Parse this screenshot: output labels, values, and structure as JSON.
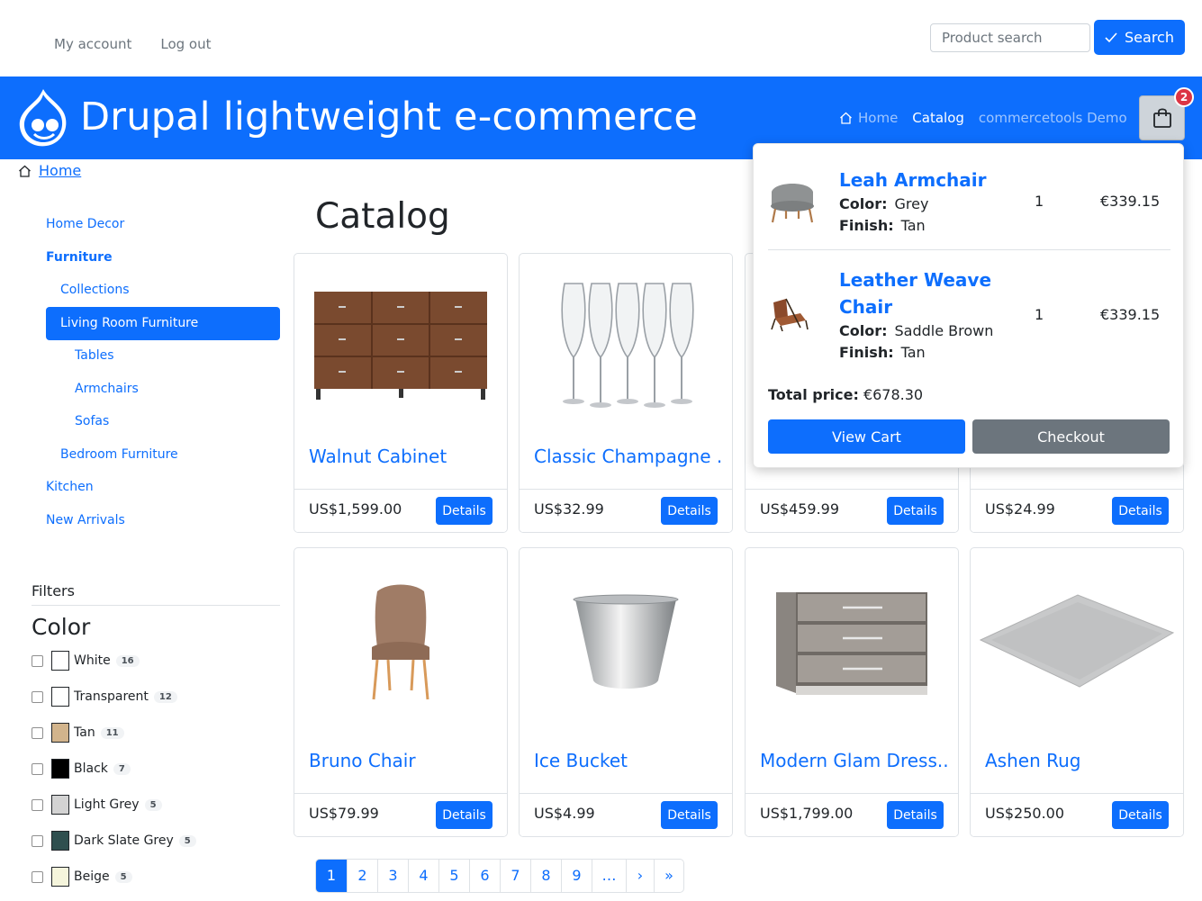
{
  "topnav": {
    "my_account": "My account",
    "logout": "Log out"
  },
  "search": {
    "placeholder": "Product search",
    "button": "Search"
  },
  "header": {
    "site_title": "Drupal lightweight e-commerce",
    "nav": {
      "home": "Home",
      "catalog": "Catalog",
      "demo": "commercetools Demo"
    },
    "cart_count": "2",
    "brand_color": "#0d6efd"
  },
  "breadcrumb": {
    "home": "Home"
  },
  "sidebar": {
    "categories": [
      {
        "label": "Home Decor"
      },
      {
        "label": "Furniture"
      },
      {
        "label": "Collections"
      },
      {
        "label": "Living Room Furniture"
      },
      {
        "label": "Tables"
      },
      {
        "label": "Armchairs"
      },
      {
        "label": "Sofas"
      },
      {
        "label": "Bedroom Furniture"
      },
      {
        "label": "Kitchen"
      },
      {
        "label": "New Arrivals"
      }
    ]
  },
  "filters": {
    "title": "Filters",
    "color_title": "Color",
    "options": [
      {
        "label": "White",
        "count": "16",
        "swatch": "#ffffff"
      },
      {
        "label": "Transparent",
        "count": "12",
        "swatch": "#ffffff"
      },
      {
        "label": "Tan",
        "count": "11",
        "swatch": "#d2b48c"
      },
      {
        "label": "Black",
        "count": "7",
        "swatch": "#000000"
      },
      {
        "label": "Light Grey",
        "count": "5",
        "swatch": "#d3d3d3"
      },
      {
        "label": "Dark Slate Grey",
        "count": "5",
        "swatch": "#2f4f4f"
      },
      {
        "label": "Beige",
        "count": "5",
        "swatch": "#f5f5dc"
      }
    ]
  },
  "catalog": {
    "title": "Catalog",
    "details_label": "Details",
    "products": [
      {
        "name": "Walnut Cabinet",
        "price": "US$1,599.00",
        "icon": "cabinet-image"
      },
      {
        "name": "Classic Champagne ...",
        "price": "US$32.99",
        "icon": "champagne-glasses-image"
      },
      {
        "name": "",
        "price": "US$459.99",
        "icon": ""
      },
      {
        "name": "",
        "price": "US$24.99",
        "icon": ""
      },
      {
        "name": "Bruno Chair",
        "price": "US$79.99",
        "icon": "chair-image"
      },
      {
        "name": "Ice Bucket",
        "price": "US$4.99",
        "icon": "ice-bucket-image"
      },
      {
        "name": "Modern Glam Dress...",
        "price": "US$1,799.00",
        "icon": "dresser-image"
      },
      {
        "name": "Ashen Rug",
        "price": "US$250.00",
        "icon": "rug-image"
      }
    ]
  },
  "pagination": [
    "1",
    "2",
    "3",
    "4",
    "5",
    "6",
    "7",
    "8",
    "9",
    "…",
    "›",
    "»"
  ],
  "cart_dropdown": {
    "items": [
      {
        "name": "Leah Armchair",
        "color_label": "Color:",
        "color": "Grey",
        "finish_label": "Finish:",
        "finish": "Tan",
        "qty": "1",
        "price": "€339.15"
      },
      {
        "name_line1": "Leather Weave",
        "name_line2": "Chair",
        "color_label": "Color:",
        "color": "Saddle Brown",
        "finish_label": "Finish:",
        "finish": "Tan",
        "qty": "1",
        "price": "€339.15"
      }
    ],
    "total_label": "Total price:",
    "total_value": "€678.30",
    "view_cart": "View Cart",
    "checkout": "Checkout"
  }
}
